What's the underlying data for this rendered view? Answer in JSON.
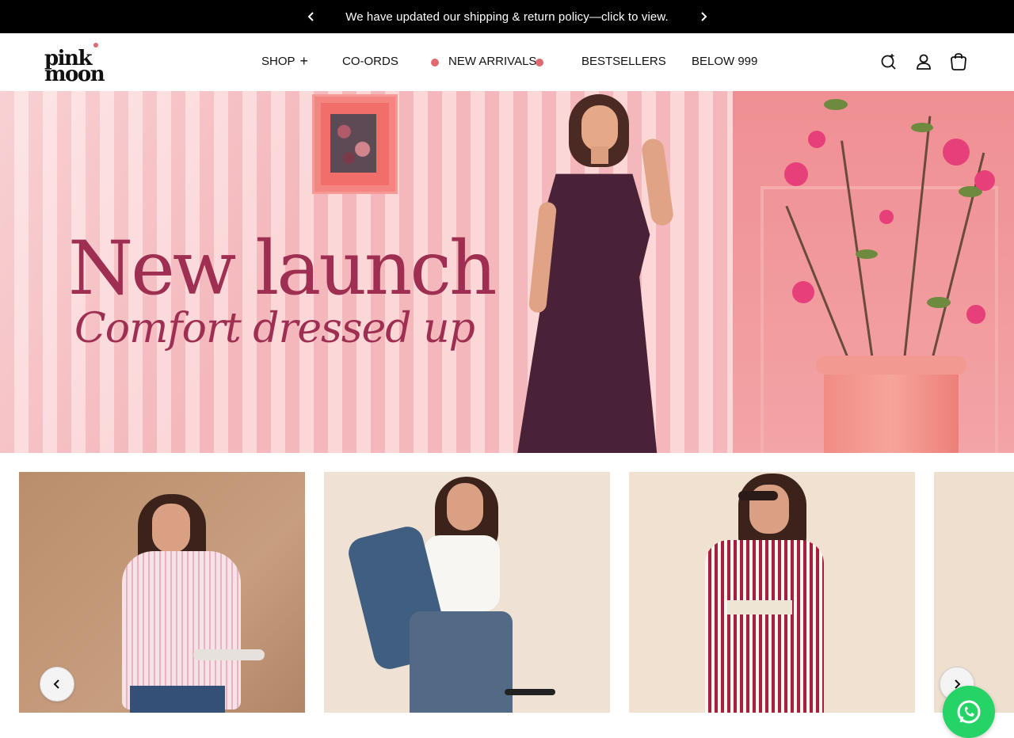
{
  "announcement": {
    "text": "We have updated our shipping & return policy—click to view.",
    "prev_icon": "chevron-left-icon",
    "next_icon": "chevron-right-icon"
  },
  "header": {
    "logo": {
      "line1": "pink",
      "line2": "moon"
    },
    "nav": [
      {
        "label": "SHOP",
        "has_plus": true
      },
      {
        "label": "CO-ORDS"
      },
      {
        "label": "NEW ARRIVALS",
        "dots": true
      },
      {
        "label": "BESTSELLERS"
      },
      {
        "label": "BELOW 999"
      }
    ],
    "icons": [
      "search-icon",
      "account-icon",
      "cart-icon"
    ],
    "accent_color": "#e06a72"
  },
  "hero": {
    "headline": "New launch",
    "subline": "Comfort dressed up",
    "text_color": "#9e2f52"
  },
  "carousel": {
    "items": [
      "product-card-1",
      "product-card-2",
      "product-card-3",
      "product-card-4"
    ],
    "prev_icon": "chevron-left-icon",
    "next_icon": "chevron-right-icon"
  },
  "chat": {
    "icon": "whatsapp-icon",
    "color": "#25d366"
  }
}
